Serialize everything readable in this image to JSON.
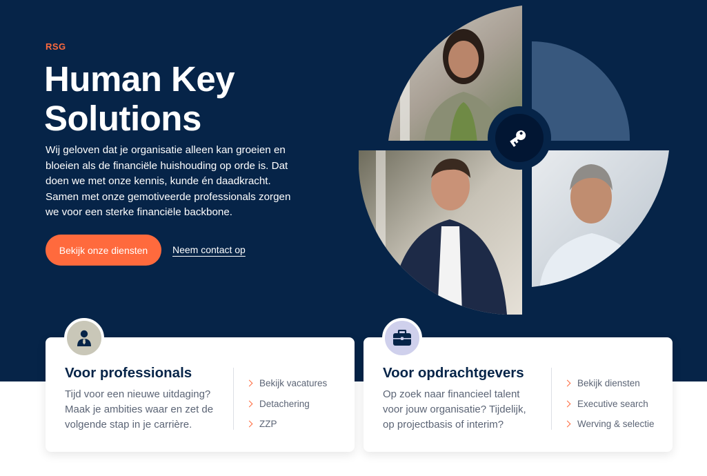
{
  "hero": {
    "eyebrow": "RSG",
    "title": "Human Key Solutions",
    "lead": "Wij geloven dat je organisatie alleen kan groeien en bloeien als de financiële huishouding op orde is. Dat doen we met onze kennis, kunde én daadkracht. Samen met onze gemotiveerde professionals zorgen we voor een sterke financiële backbone.",
    "primary_button": "Bekijk onze diensten",
    "secondary_link": "Neem contact op"
  },
  "cards": [
    {
      "icon": "user-tie-icon",
      "title": "Voor professionals",
      "text": "Tijd voor een nieuwe uitdaging? Maak je ambities waar en zet de volgende stap in je carrière.",
      "links": [
        "Bekijk vacatures",
        "Detachering",
        "ZZP"
      ]
    },
    {
      "icon": "briefcase-icon",
      "title": "Voor opdrachtgevers",
      "text": "Op zoek naar financieel talent voor jouw organisatie? Tijdelijk, op projectbasis of interim?",
      "links": [
        "Bekijk diensten",
        "Executive search",
        "Werving & selectie"
      ]
    }
  ],
  "colors": {
    "navy": "#062448",
    "accent": "#ff6a3d",
    "text_muted": "#5b6475"
  }
}
